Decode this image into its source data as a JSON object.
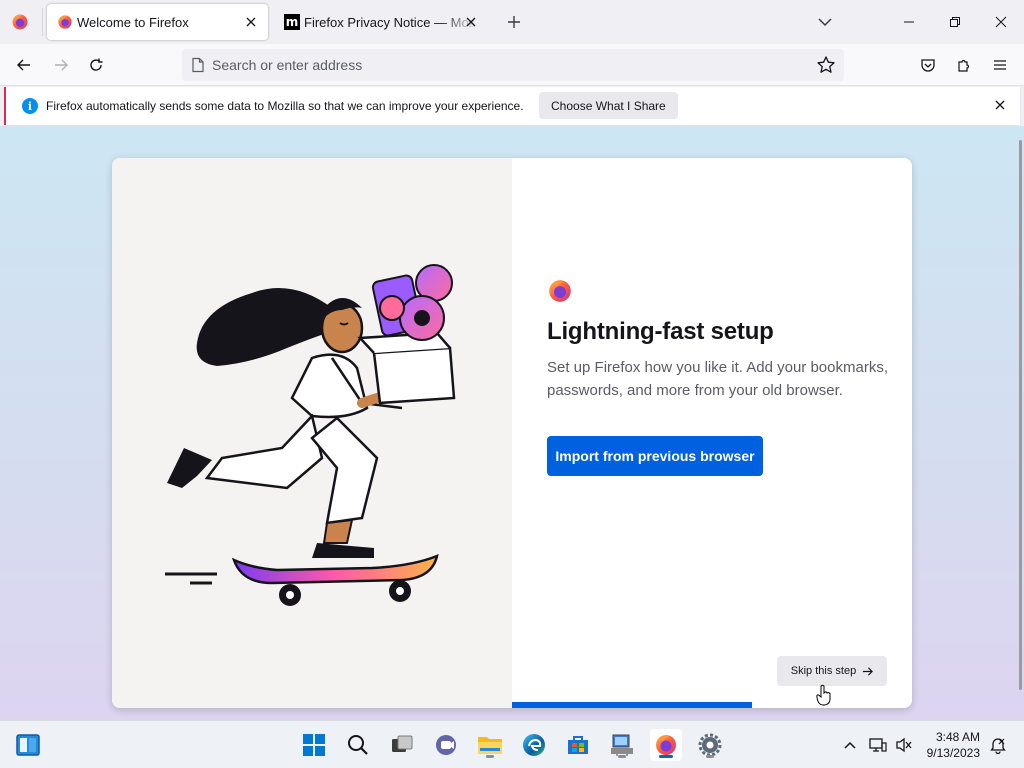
{
  "tabs": [
    {
      "title": "Welcome to Firefox",
      "active": true
    },
    {
      "title": "Firefox Privacy Notice — Mozilla",
      "active": false
    }
  ],
  "toolbar": {
    "url_placeholder": "Search or enter address"
  },
  "notification": {
    "message": "Firefox automatically sends some data to Mozilla so that we can improve your experience.",
    "button": "Choose What I Share"
  },
  "onboarding": {
    "title": "Lightning-fast setup",
    "subtitle": "Set up Firefox how you like it. Add your bookmarks, passwords, and more from your old browser.",
    "primary_button": "Import from previous browser",
    "skip_button": "Skip this step",
    "progress": 0.6
  },
  "taskbar": {
    "apps": [
      "start-icon",
      "search-icon",
      "task-view-icon",
      "chat-icon",
      "file-explorer-icon",
      "edge-icon",
      "store-icon",
      "network-app-icon",
      "firefox-icon",
      "settings-icon"
    ],
    "active_app": "firefox-icon"
  },
  "clock": {
    "time": "3:48 AM",
    "date": "9/13/2023"
  },
  "colors": {
    "accent": "#0061e0",
    "tab_strip": "#f0f0f4",
    "notification_border": "#e22850"
  }
}
